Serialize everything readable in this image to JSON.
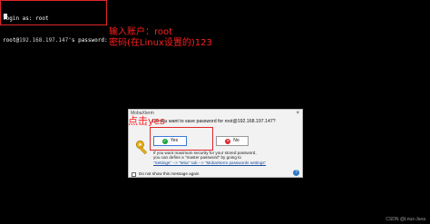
{
  "terminal": {
    "login_line": "login as: root",
    "password_prompt_user": "root@",
    "password_prompt_ip": "192.168.197.147",
    "password_prompt_suffix": "'s password:"
  },
  "annotations": {
    "user_note": "输入账户：root",
    "password_note": "密码(在Linux设置的)123",
    "click_yes_note": "点击yes",
    "annotation_color": "#ff1f1f"
  },
  "dialog": {
    "title": "MobaXterm",
    "close_icon": "×",
    "question": "Do you want to save password for root@192.168.197.147?",
    "yes_label": "Yes",
    "no_label": "No",
    "info_line_1": "If you want maximum security for your stored password,",
    "info_line_2": "you can define a \"master password\" by going to",
    "info_line_3": "\"Settings\" --> \"Misc\" tab --> \"MobaXterm passwords settings\"",
    "dont_show_label": "Do not show this message again",
    "help_icon": "?"
  },
  "watermark": "CSDN @Lnux-Java"
}
